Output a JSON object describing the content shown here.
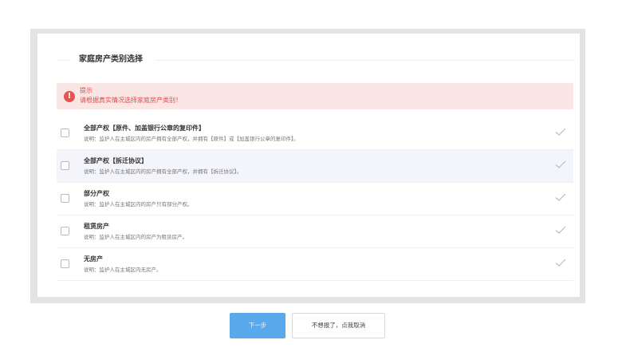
{
  "section": {
    "title": "家庭房产类别选择"
  },
  "notice": {
    "icon": "exclamation-icon",
    "title": "提示",
    "text": "请根据真实情况选择家庭房产类别！"
  },
  "options": [
    {
      "label": "全部产权【原件、加盖银行公章的复印件】",
      "desc": "说明：监护人在主城区内的房产拥有全部产权，并拥有【原件】或【加盖银行公章的复印件】。",
      "highlighted": false
    },
    {
      "label": "全部产权【拆迁协议】",
      "desc": "说明：监护人在主城区内的房产拥有全部产权，并拥有【拆迁协议】。",
      "highlighted": true
    },
    {
      "label": "部分产权",
      "desc": "说明：监护人在主城区内的房产只有部分产权。",
      "highlighted": false
    },
    {
      "label": "租赁房产",
      "desc": "说明：监护人在主城区内的房产为租赁房产。",
      "highlighted": false
    },
    {
      "label": "无房产",
      "desc": "说明：监护人在主城区内无房产。",
      "highlighted": false
    }
  ],
  "buttons": {
    "next": "下一步",
    "cancel": "不想报了，点我取消"
  },
  "colors": {
    "accent": "#5aa9ec",
    "warning": "#e55353",
    "warning_bg": "#fbe6e6"
  }
}
